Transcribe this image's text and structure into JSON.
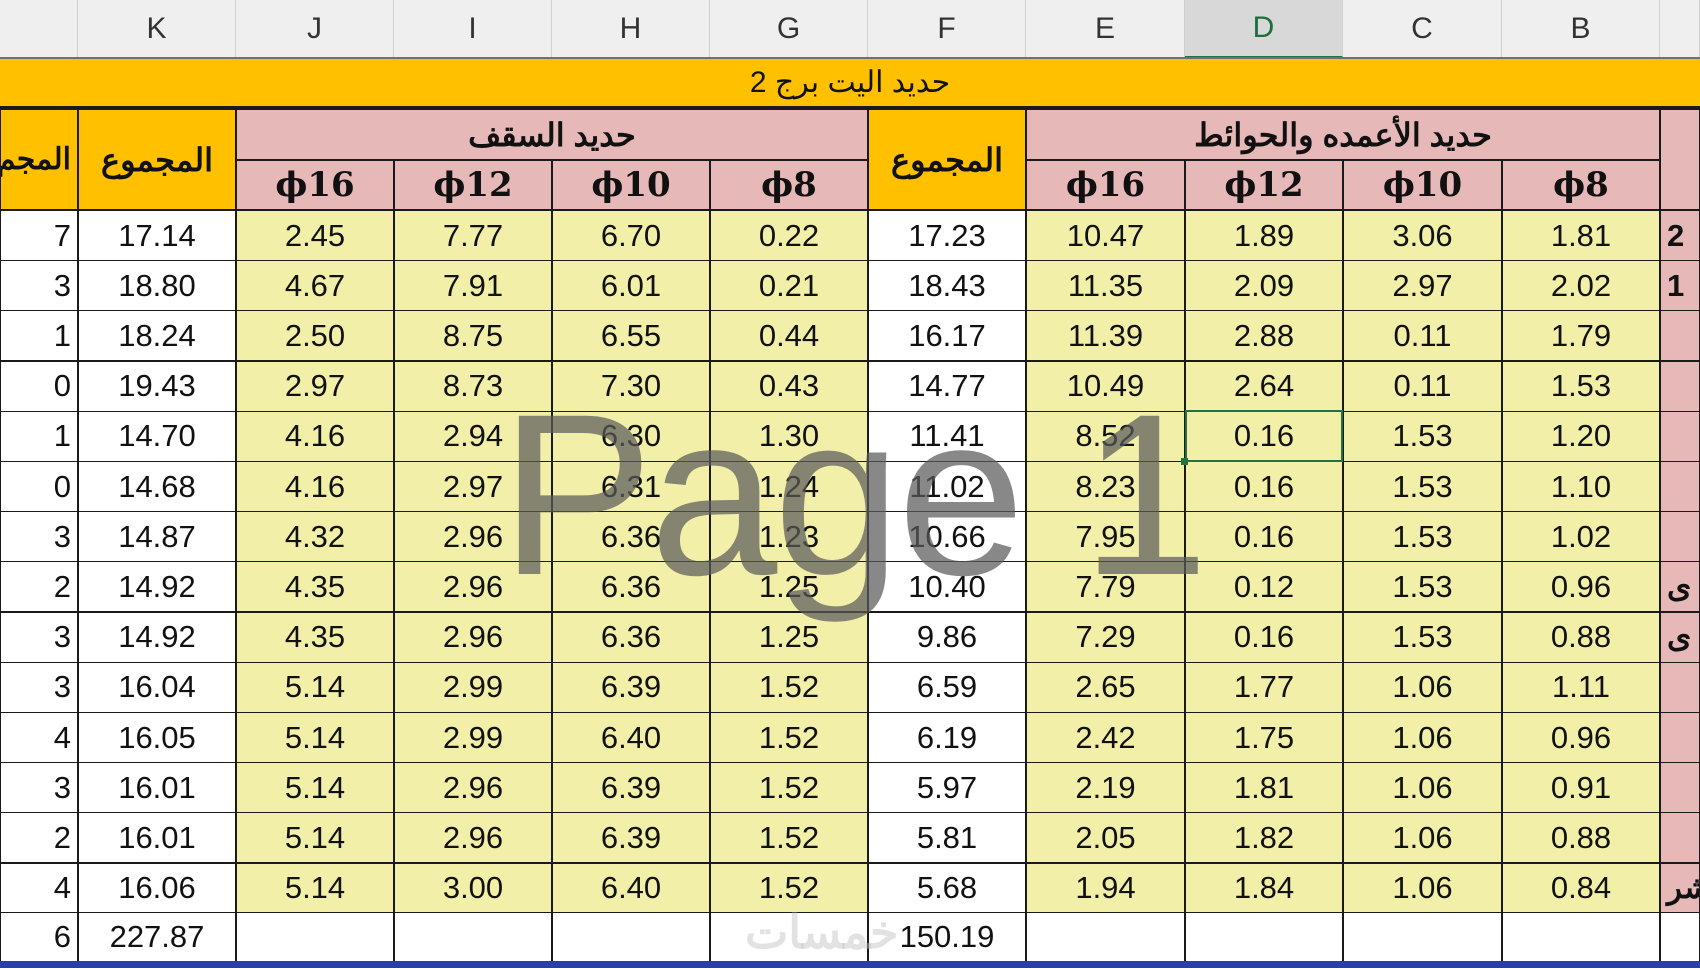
{
  "columns": [
    "K",
    "J",
    "I",
    "H",
    "G",
    "F",
    "E",
    "D",
    "C",
    "B"
  ],
  "selected_column": "D",
  "title": "حديد اليت برج 2",
  "groups": {
    "ceiling": "حديد السقف",
    "columns_walls": "حديد الأعمده والحوائط",
    "total": "المجموع",
    "total_partial": "المجم"
  },
  "diameters": [
    "ϕ16",
    "ϕ12",
    "ϕ10",
    "ϕ8"
  ],
  "rows": [
    {
      "left": "7",
      "K": "17.14",
      "J": "2.45",
      "I": "7.77",
      "H": "6.70",
      "G": "0.22",
      "F": "17.23",
      "E": "10.47",
      "D": "1.89",
      "C": "3.06",
      "B": "1.81",
      "right": "2"
    },
    {
      "left": "3",
      "K": "18.80",
      "J": "4.67",
      "I": "7.91",
      "H": "6.01",
      "G": "0.21",
      "F": "18.43",
      "E": "11.35",
      "D": "2.09",
      "C": "2.97",
      "B": "2.02",
      "right": "1"
    },
    {
      "left": "1",
      "K": "18.24",
      "J": "2.50",
      "I": "8.75",
      "H": "6.55",
      "G": "0.44",
      "F": "16.17",
      "E": "11.39",
      "D": "2.88",
      "C": "0.11",
      "B": "1.79",
      "right": ""
    },
    {
      "left": "0",
      "K": "19.43",
      "J": "2.97",
      "I": "8.73",
      "H": "7.30",
      "G": "0.43",
      "F": "14.77",
      "E": "10.49",
      "D": "2.64",
      "C": "0.11",
      "B": "1.53",
      "right": ""
    },
    {
      "left": "1",
      "K": "14.70",
      "J": "4.16",
      "I": "2.94",
      "H": "6.30",
      "G": "1.30",
      "F": "11.41",
      "E": "8.52",
      "D": "0.16",
      "C": "1.53",
      "B": "1.20",
      "right": ""
    },
    {
      "left": "0",
      "K": "14.68",
      "J": "4.16",
      "I": "2.97",
      "H": "6.31",
      "G": "1.24",
      "F": "11.02",
      "E": "8.23",
      "D": "0.16",
      "C": "1.53",
      "B": "1.10",
      "right": ""
    },
    {
      "left": "3",
      "K": "14.87",
      "J": "4.32",
      "I": "2.96",
      "H": "6.36",
      "G": "1.23",
      "F": "10.66",
      "E": "7.95",
      "D": "0.16",
      "C": "1.53",
      "B": "1.02",
      "right": ""
    },
    {
      "left": "2",
      "K": "14.92",
      "J": "4.35",
      "I": "2.96",
      "H": "6.36",
      "G": "1.25",
      "F": "10.40",
      "E": "7.79",
      "D": "0.12",
      "C": "1.53",
      "B": "0.96",
      "right": "ى"
    },
    {
      "left": "3",
      "K": "14.92",
      "J": "4.35",
      "I": "2.96",
      "H": "6.36",
      "G": "1.25",
      "F": "9.86",
      "E": "7.29",
      "D": "0.16",
      "C": "1.53",
      "B": "0.88",
      "right": "ى"
    },
    {
      "left": "3",
      "K": "16.04",
      "J": "5.14",
      "I": "2.99",
      "H": "6.39",
      "G": "1.52",
      "F": "6.59",
      "E": "2.65",
      "D": "1.77",
      "C": "1.06",
      "B": "1.11",
      "right": ""
    },
    {
      "left": "4",
      "K": "16.05",
      "J": "5.14",
      "I": "2.99",
      "H": "6.40",
      "G": "1.52",
      "F": "6.19",
      "E": "2.42",
      "D": "1.75",
      "C": "1.06",
      "B": "0.96",
      "right": ""
    },
    {
      "left": "3",
      "K": "16.01",
      "J": "5.14",
      "I": "2.96",
      "H": "6.39",
      "G": "1.52",
      "F": "5.97",
      "E": "2.19",
      "D": "1.81",
      "C": "1.06",
      "B": "0.91",
      "right": ""
    },
    {
      "left": "2",
      "K": "16.01",
      "J": "5.14",
      "I": "2.96",
      "H": "6.39",
      "G": "1.52",
      "F": "5.81",
      "E": "2.05",
      "D": "1.82",
      "C": "1.06",
      "B": "0.88",
      "right": ""
    },
    {
      "left": "4",
      "K": "16.06",
      "J": "5.14",
      "I": "3.00",
      "H": "6.40",
      "G": "1.52",
      "F": "5.68",
      "E": "1.94",
      "D": "1.84",
      "C": "1.06",
      "B": "0.84",
      "right": "شر"
    }
  ],
  "totals": {
    "left": "6",
    "K": "227.87",
    "F": "150.19"
  },
  "watermark": "Page 1",
  "faint_logo": "خمسات"
}
